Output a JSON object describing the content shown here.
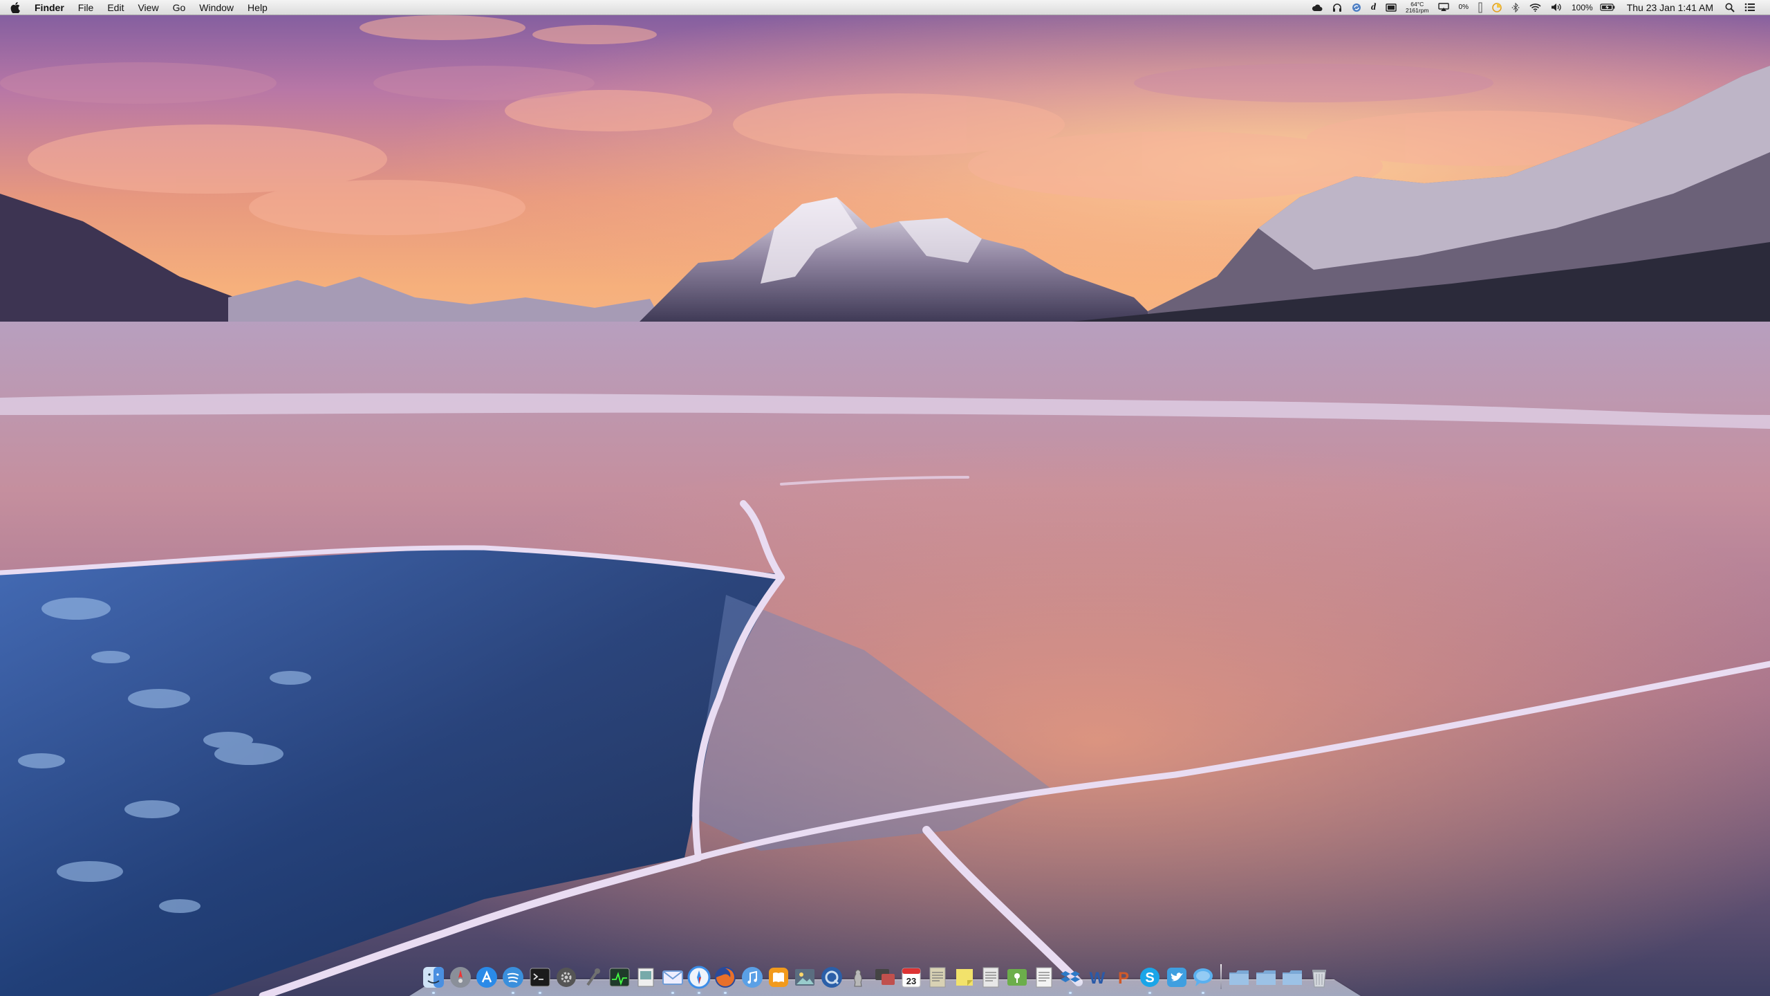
{
  "menubar": {
    "apple_icon": "apple-logo-icon",
    "app_name": "Finder",
    "menus": [
      "File",
      "Edit",
      "View",
      "Go",
      "Window",
      "Help"
    ],
    "status": {
      "temperature": "64°C",
      "fan_speed": "2161rpm",
      "battery_gauge": "0%",
      "battery_percent": "100%",
      "datetime": "Thu 23 Jan  1:41 AM"
    },
    "status_icons": [
      "cloud-icon",
      "headphones-icon",
      "sync-icon",
      "d-letter-icon",
      "display-icon",
      "airplay-icon",
      "activity-bar-icon",
      "cpu-gauge-icon",
      "bluetooth-icon",
      "wifi-icon",
      "volume-icon",
      "battery-icon",
      "spotlight-search-icon",
      "notification-center-icon"
    ]
  },
  "dock": {
    "apps": [
      {
        "name": "finder-icon",
        "color": "#4a8fe0",
        "running": true
      },
      {
        "name": "launchpad-icon",
        "color": "#8a8f99",
        "running": false
      },
      {
        "name": "app-store-icon",
        "color": "#2a8ae8",
        "running": false
      },
      {
        "name": "spotify-icon",
        "color": "#3a8fdc",
        "running": true
      },
      {
        "name": "terminal-icon",
        "color": "#1b1b1b",
        "running": true
      },
      {
        "name": "settings-icon",
        "color": "#555555",
        "running": false
      },
      {
        "name": "tools-icon",
        "color": "#707070",
        "running": false
      },
      {
        "name": "activity-monitor-icon",
        "color": "#1f3a2a",
        "running": false
      },
      {
        "name": "preview-icon",
        "color": "#9aa3ad",
        "running": false
      },
      {
        "name": "mail-icon",
        "color": "#6f9bd6",
        "running": true
      },
      {
        "name": "safari-icon",
        "color": "#3c8ee8",
        "running": true
      },
      {
        "name": "firefox-icon",
        "color": "#e8702a",
        "running": true
      },
      {
        "name": "itunes-icon",
        "color": "#5aa0e6",
        "running": false
      },
      {
        "name": "ibooks-icon",
        "color": "#f29a1c",
        "running": false
      },
      {
        "name": "photos-icon",
        "color": "#5a6d80",
        "running": false
      },
      {
        "name": "quicktime-icon",
        "color": "#2b5fa8",
        "running": false
      },
      {
        "name": "chess-icon",
        "color": "#b8b8b8",
        "running": false
      },
      {
        "name": "remote-desktop-icon",
        "color": "#c0504d",
        "running": false
      },
      {
        "name": "calendar-icon",
        "color": "#ffffff",
        "running": false
      },
      {
        "name": "notes-icon",
        "color": "#d9d2b4",
        "running": false
      },
      {
        "name": "stickies-icon",
        "color": "#f2e26b",
        "running": false
      },
      {
        "name": "textedit-icon",
        "color": "#e8e8e8",
        "running": false
      },
      {
        "name": "maps-icon",
        "color": "#6cae4b",
        "running": false
      },
      {
        "name": "textwrangler-icon",
        "color": "#f4f4f4",
        "running": false
      },
      {
        "name": "dropbox-icon",
        "color": "#2d79c7",
        "running": true
      },
      {
        "name": "word-icon",
        "color": "#2a5aa8",
        "running": false
      },
      {
        "name": "powerpoint-icon",
        "color": "#d05a2a",
        "running": false
      },
      {
        "name": "skype-icon",
        "color": "#1aa5e8",
        "running": true
      },
      {
        "name": "twitter-icon",
        "color": "#3f9fe0",
        "running": false
      },
      {
        "name": "messages-icon",
        "color": "#5ab0ef",
        "running": true
      }
    ],
    "stacks": [
      {
        "name": "applications-folder-icon",
        "color": "#7ba9d6"
      },
      {
        "name": "documents-folder-icon",
        "color": "#7ba9d6"
      },
      {
        "name": "downloads-folder-icon",
        "color": "#7ba9d6"
      },
      {
        "name": "trash-icon",
        "color": "#9aa0a8"
      }
    ],
    "calendar_day": "23"
  }
}
